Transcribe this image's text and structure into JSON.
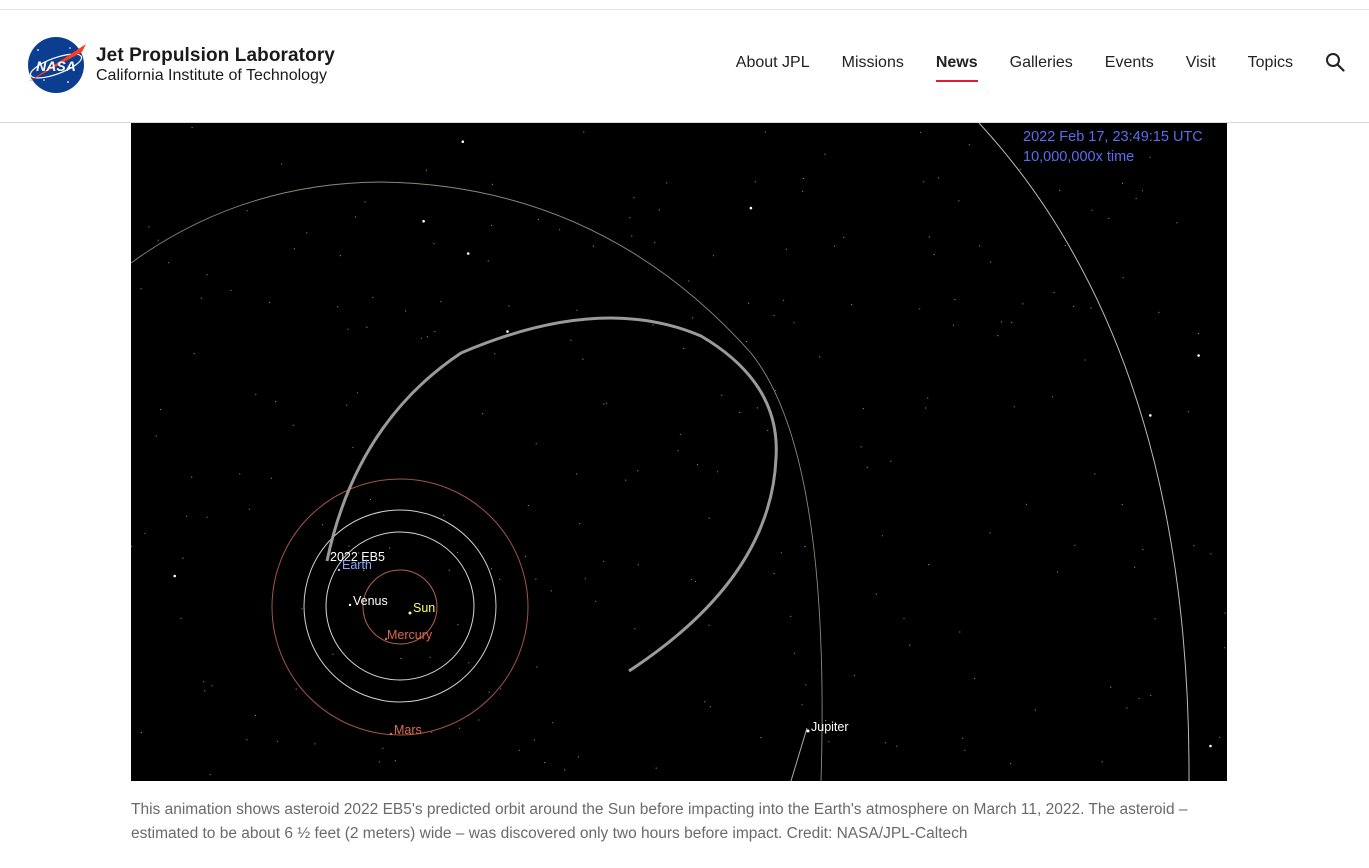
{
  "header": {
    "logo_badge_text": "NASA",
    "lab_name": "Jet Propulsion Laboratory",
    "institute": "California Institute of Technology",
    "nav": [
      {
        "label": "About JPL",
        "active": false
      },
      {
        "label": "Missions",
        "active": false
      },
      {
        "label": "News",
        "active": true
      },
      {
        "label": "Galleries",
        "active": false
      },
      {
        "label": "Events",
        "active": false
      },
      {
        "label": "Visit",
        "active": false
      },
      {
        "label": "Topics",
        "active": false
      }
    ],
    "accent_color": "#e31937"
  },
  "animation": {
    "timestamp": "2022 Feb 17, 23:49:15 UTC",
    "speed": "10,000,000x time",
    "overlay_color": "#5b6cf0",
    "labels": {
      "asteroid": "2022 EB5",
      "earth": "Earth",
      "venus": "Venus",
      "sun": "Sun",
      "mercury": "Mercury",
      "mars": "Mars",
      "jupiter": "Jupiter"
    }
  },
  "caption": "This animation shows asteroid 2022 EB5's predicted orbit around the Sun before impacting into the Earth's atmosphere on March 11, 2022. The asteroid – estimated to be about 6 ½ feet (2 meters) wide – was discovered only two hours before impact. Credit: NASA/JPL-Caltech"
}
